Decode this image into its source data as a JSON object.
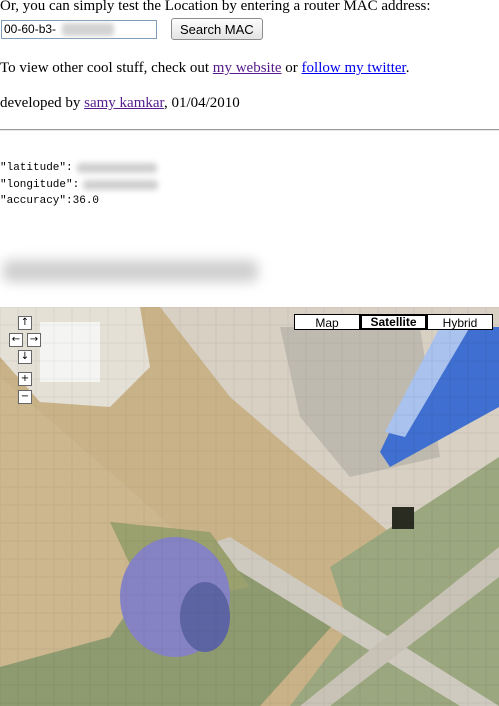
{
  "intro": {
    "text": "Or, you can simply test the Location by entering a router MAC address:"
  },
  "mac_form": {
    "input_value": "00-60-b3-",
    "button_label": "Search MAC"
  },
  "links_line": {
    "prefix": "To view other cool stuff, check out ",
    "website_link": "my website",
    "connector": " or ",
    "twitter_link": "follow my twitter",
    "suffix": "."
  },
  "credit_line": {
    "prefix": "developed by ",
    "author_link": "samy kamkar",
    "suffix": ", 01/04/2010"
  },
  "result": {
    "latitude_key": "\"latitude\":",
    "longitude_key": "\"longitude\":",
    "accuracy_line": "\"accuracy\":36.0"
  },
  "map": {
    "controls": {
      "pan_up": "↑",
      "pan_left": "←",
      "pan_right": "→",
      "pan_down": "↓",
      "zoom_in": "+",
      "zoom_out": "−"
    },
    "types": [
      {
        "label": "Map",
        "active": false
      },
      {
        "label": "Satellite",
        "active": true
      },
      {
        "label": "Hybrid",
        "active": false
      }
    ]
  },
  "colors": {
    "link_visited": "#551a8b",
    "link_unvisited": "#0000ee",
    "field": "#cbb48b",
    "grass": "#8c9c72",
    "road": "#c2c0b5",
    "pool": "#8584c2",
    "water": "#4f7fd6"
  }
}
